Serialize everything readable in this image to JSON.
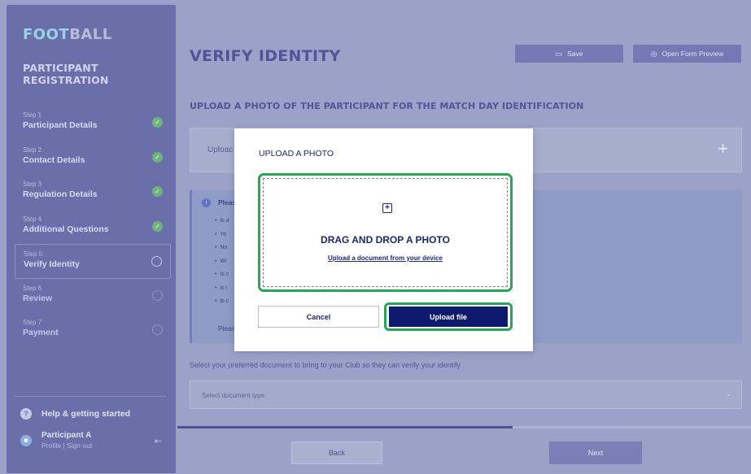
{
  "sidebar": {
    "logo_part1": "FOOT",
    "logo_part2": "BALL",
    "registration_title": "PARTICIPANT REGISTRATION",
    "steps": [
      {
        "num": "Step 1",
        "label": "Participant Details",
        "status": "complete"
      },
      {
        "num": "Step 2",
        "label": "Contact Details",
        "status": "complete"
      },
      {
        "num": "Step 3",
        "label": "Regulation Details",
        "status": "complete"
      },
      {
        "num": "Step 4",
        "label": "Additional Questions",
        "status": "complete"
      },
      {
        "num": "Step 5",
        "label": "Verify Identity",
        "status": "active"
      },
      {
        "num": "Step 6",
        "label": "Review",
        "status": "pending"
      },
      {
        "num": "Step 7",
        "label": "Payment",
        "status": "pending"
      }
    ],
    "help_label": "Help & getting started",
    "user": {
      "name": "Participant A",
      "links": "Profile | Sign out"
    }
  },
  "header": {
    "title": "VERIFY IDENTITY",
    "save_label": "Save",
    "preview_label": "Open Form Preview"
  },
  "main": {
    "section_heading": "UPLOAD A PHOTO OF THE PARTICIPANT FOR THE MATCH DAY IDENTIFICATION",
    "upload_label": "Uploac",
    "info_title": "Pleas",
    "info_items": [
      "Is a",
      "Yo",
      "No",
      "Wi",
      "Is c",
      "Is i",
      "Is c"
    ],
    "info_footer": "Pleas",
    "document_label": "Select your preferred document to bring to your Club so they can verify your identify",
    "document_placeholder": "Select document type",
    "progress": 0.585
  },
  "footer": {
    "back_label": "Back",
    "next_label": "Next"
  },
  "modal": {
    "title": "UPLOAD A PHOTO",
    "drop_title": "DRAG AND DROP A PHOTO",
    "upload_link": "Upload a document from your device",
    "cancel_label": "Cancel",
    "upload_label": "Upload file"
  },
  "icons": {
    "check": "check-icon",
    "save": "save-icon",
    "eye": "eye-icon",
    "plus": "plus-icon",
    "info": "info-icon",
    "chevron": "chevron-down-icon",
    "help": "help-icon",
    "signout": "sign-out-icon",
    "add_file": "add-file-icon"
  },
  "colors": {
    "sidebar_bg": "#6a6faa",
    "highlight_green": "#2aa45a",
    "primary_navy": "#0d1a6e",
    "check_green": "#6fb27a"
  }
}
